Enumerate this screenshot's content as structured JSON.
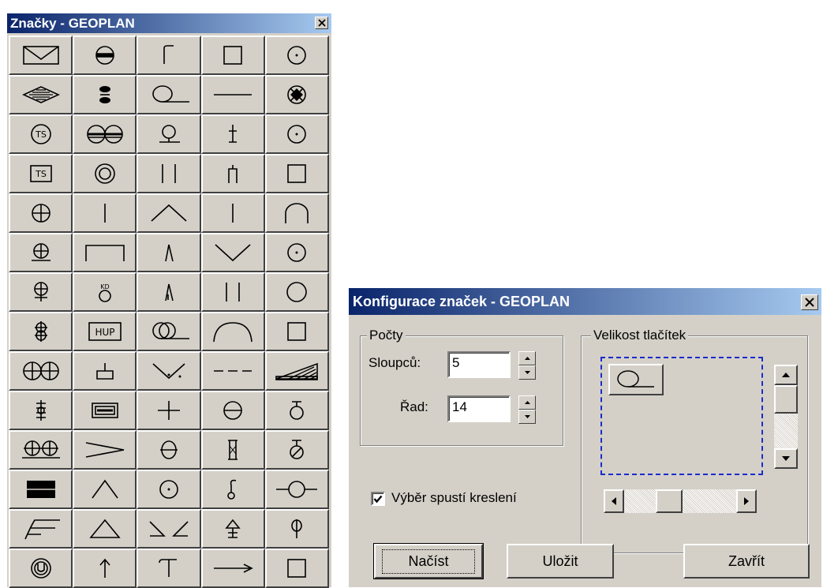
{
  "palette": {
    "title": "Značky - GEOPLAN",
    "close_symbol": "×",
    "rows": 14,
    "columns": 5,
    "symbols": [
      [
        "envelope-icon",
        "striped-circle-icon",
        "hook-line-icon",
        "square-icon",
        "dotted-circle-icon"
      ],
      [
        "hatched-diamond-icon",
        "hourglass-icon",
        "circle-underline-icon",
        "horizontal-line-icon",
        "crossed-circle-icon"
      ],
      [
        "ts-circle-icon",
        "double-striped-circle-icon",
        "circle-on-line-icon",
        "dagger-icon",
        "dotted-circle-icon"
      ],
      [
        "ts-box-icon",
        "double-circle-icon",
        "double-vertical-line-icon",
        "fork-icon",
        "square-icon"
      ],
      [
        "crosshair-circle-icon",
        "vertical-line-icon",
        "chevron-up-icon",
        "vertical-line-icon",
        "arch-icon"
      ],
      [
        "crosshair-circle-underline-icon",
        "open-rectangle-icon",
        "lambda-icon",
        "chevron-down-icon",
        "dotted-circle-icon"
      ],
      [
        "crosshair-circle-stem-icon",
        "kd-circle-icon",
        "lambda-tick-icon",
        "double-vertical-line-icon",
        "circle-icon"
      ],
      [
        "stacked-crossed-circles-icon",
        "hup-box-icon",
        "double-circle-underline-icon",
        "dome-icon",
        "square-icon"
      ],
      [
        "double-crosshair-circle-icon",
        "box-stem-icon",
        "dotted-v-icon",
        "dashed-line-icon",
        "hatched-wedge-icon"
      ],
      [
        "stacked-cross-icon",
        "double-rectangle-icon",
        "plus-icon",
        "minus-circle-icon",
        "circle-stem-top-icon"
      ],
      [
        "double-crosshair-underline-icon",
        "greater-than-icon",
        "theta-icon",
        "hourglass-stem-icon",
        "slashed-circle-stem-icon"
      ],
      [
        "filled-box-icon",
        "caret-icon",
        "dotted-circle-icon",
        "hook-stem-icon",
        "circle-on-wire-icon"
      ],
      [
        "slant-lines-icon",
        "triangle-icon",
        "corner-brackets-icon",
        "arrow-up-stem-icon",
        "phi-icon"
      ],
      [
        "u-circle-icon",
        "arrow-up-icon",
        "t-hook-icon",
        "arrow-right-icon",
        "square-icon"
      ]
    ]
  },
  "dialog": {
    "title": "Konfigurace značek - GEOPLAN",
    "close_symbol": "×",
    "counts_group": "Počty",
    "columns_label": "Sloupců:",
    "columns_value": "5",
    "rows_label": "Řad:",
    "rows_value": "14",
    "size_group": "Velikost tlačítek",
    "preview_icon": "circle-underline-icon",
    "checkbox_label": "Výběr spustí kreslení",
    "checkbox_checked": true,
    "load_button": "Načíst",
    "save_button": "Uložit",
    "close_button": "Zavřít"
  },
  "colors": {
    "face": "#d4d0c8",
    "title_start": "#0a246a",
    "title_end": "#a6caf0",
    "focus_dash": "#1a2ccc"
  }
}
